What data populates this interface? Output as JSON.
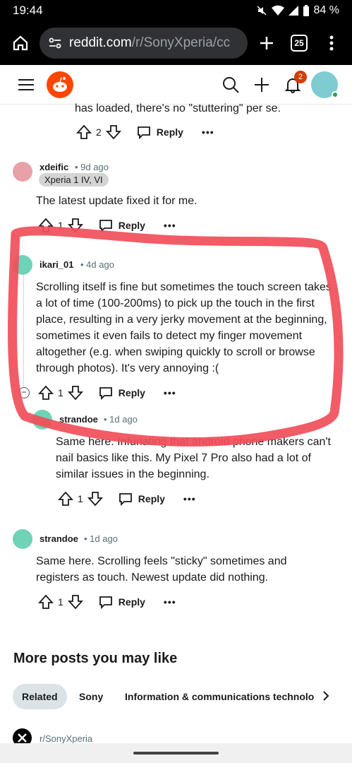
{
  "status": {
    "time": "19:44",
    "battery": "84 %"
  },
  "browser": {
    "domain": "reddit.com",
    "path": "/r/SonyXperia/cc",
    "tab_count": "25"
  },
  "header": {
    "notif_count": "2"
  },
  "prev_comment": {
    "tail_text": "has loaded, there's no \"stuttering\" per se.",
    "votes": "2",
    "reply": "Reply",
    "more": "•••"
  },
  "comments": [
    {
      "user": "xdeific",
      "age": "• 9d ago",
      "flair": "Xperia 1 IV, VI",
      "text": "The latest update fixed it for me.",
      "votes": "1",
      "reply": "Reply",
      "more": "•••",
      "avatar_color": "#e8a1a8"
    },
    {
      "user": "ikari_01",
      "age": "• 4d ago",
      "text": "Scrolling itself is fine but sometimes the touch screen takes a lot of time (100-200ms) to pick up the touch in the first place, resulting in a very jerky movement at the beginning, sometimes it even fails to detect my finger movement altogether (e.g. when swiping quickly to scroll or browse through photos). It's very annoying :(",
      "votes": "1",
      "reply": "Reply",
      "more": "•••",
      "avatar_color": "#6fd3b8"
    },
    {
      "user": "strandoe",
      "age": "• 1d ago",
      "text": "Same here. Infuriating that android phone makers can't nail basics like this. My Pixel 7 Pro also had a lot of similar issues in the beginning.",
      "votes": "1",
      "reply": "Reply",
      "more": "•••",
      "avatar_color": "#6fd3b8"
    },
    {
      "user": "strandoe",
      "age": "• 1d ago",
      "text": "Same here. Scrolling feels \"sticky\" sometimes and registers as touch. Newest update did nothing.",
      "votes": "1",
      "reply": "Reply",
      "more": "•••",
      "avatar_color": "#6fd3b8"
    }
  ],
  "more_posts": {
    "title": "More posts you may like",
    "tabs": [
      "Related",
      "Sony",
      "Information & communications technology"
    ],
    "first_post_sub": "r/SonyXperia"
  },
  "colors": {
    "accent": "#ff4500",
    "annotation": "#f0505a",
    "badge": "#d93a00"
  }
}
